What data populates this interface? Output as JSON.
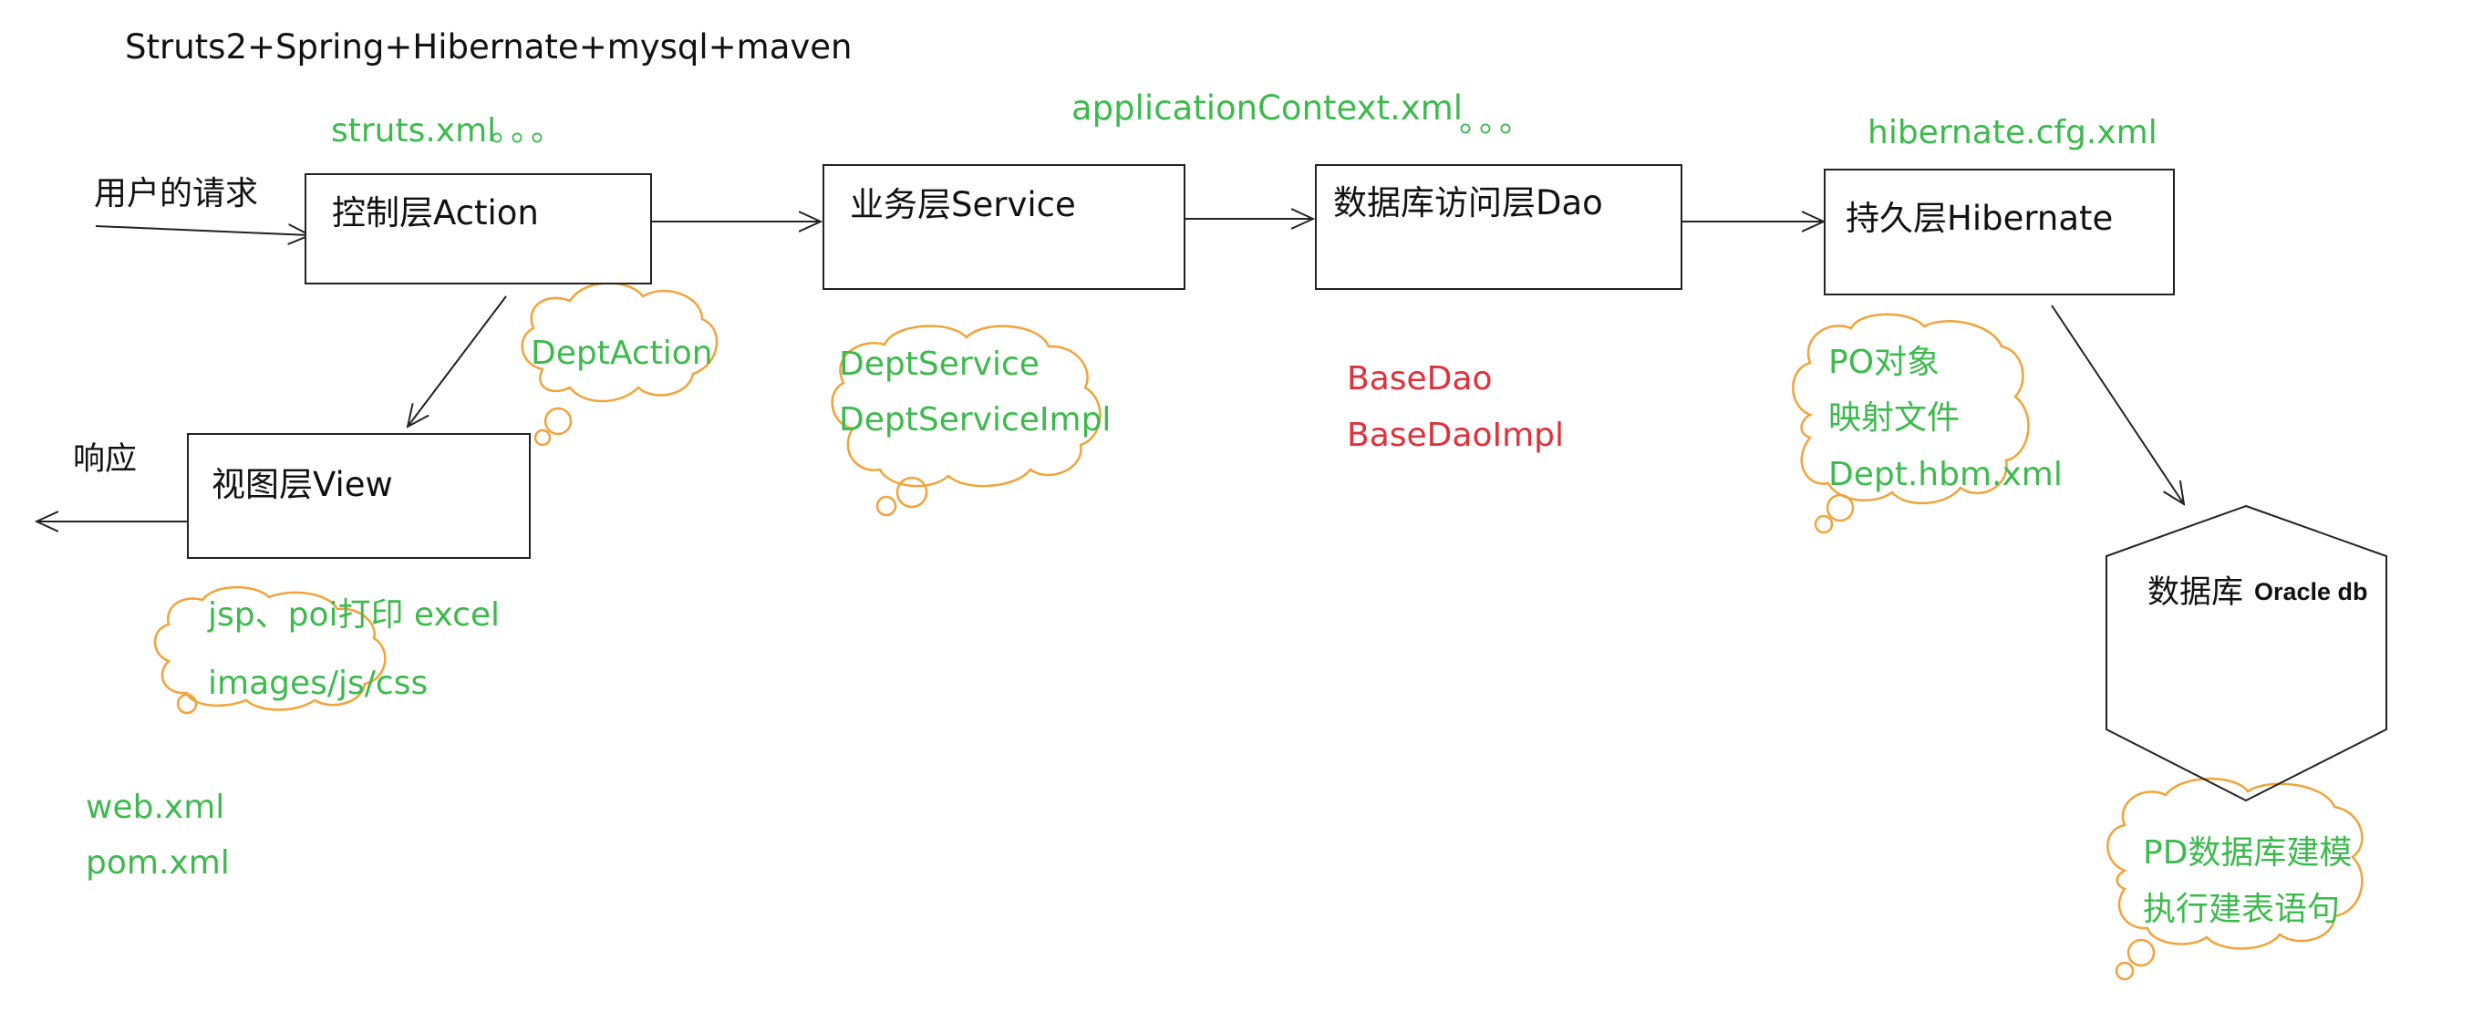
{
  "title": "Struts2+Spring+Hibernate+mysql+maven",
  "config_labels": {
    "struts": "struts.xml",
    "struts_dots": "。。。",
    "app_context": "applicationContext.xml",
    "app_dots": "。。。",
    "hibernate_cfg": "hibernate.cfg.xml",
    "web_xml": "web.xml",
    "pom_xml": "pom.xml"
  },
  "request_label": "用户的请求",
  "response_label": "响应",
  "layers": {
    "action": "控制层Action",
    "service": "业务层Service",
    "dao": "数据库访问层Dao",
    "hibernate": "持久层Hibernate",
    "view": "视图层View",
    "database": "数据库",
    "database_sub": "Oracle db"
  },
  "clouds": {
    "action": [
      "DeptAction"
    ],
    "service": [
      "DeptService",
      "DeptServiceImpl"
    ],
    "hibernate": [
      "PO对象",
      "映射文件",
      "Dept.hbm.xml"
    ],
    "view": [
      "jsp、poi打印 excel",
      "images/js/css"
    ],
    "database": [
      "PD数据库建模",
      "执行建表语句"
    ]
  },
  "dao_classes": [
    "BaseDao",
    "BaseDaoImpl"
  ],
  "colors": {
    "green": "#3dba4e",
    "orange": "#f2a33a",
    "red": "#e0303b",
    "line": "#222222"
  }
}
